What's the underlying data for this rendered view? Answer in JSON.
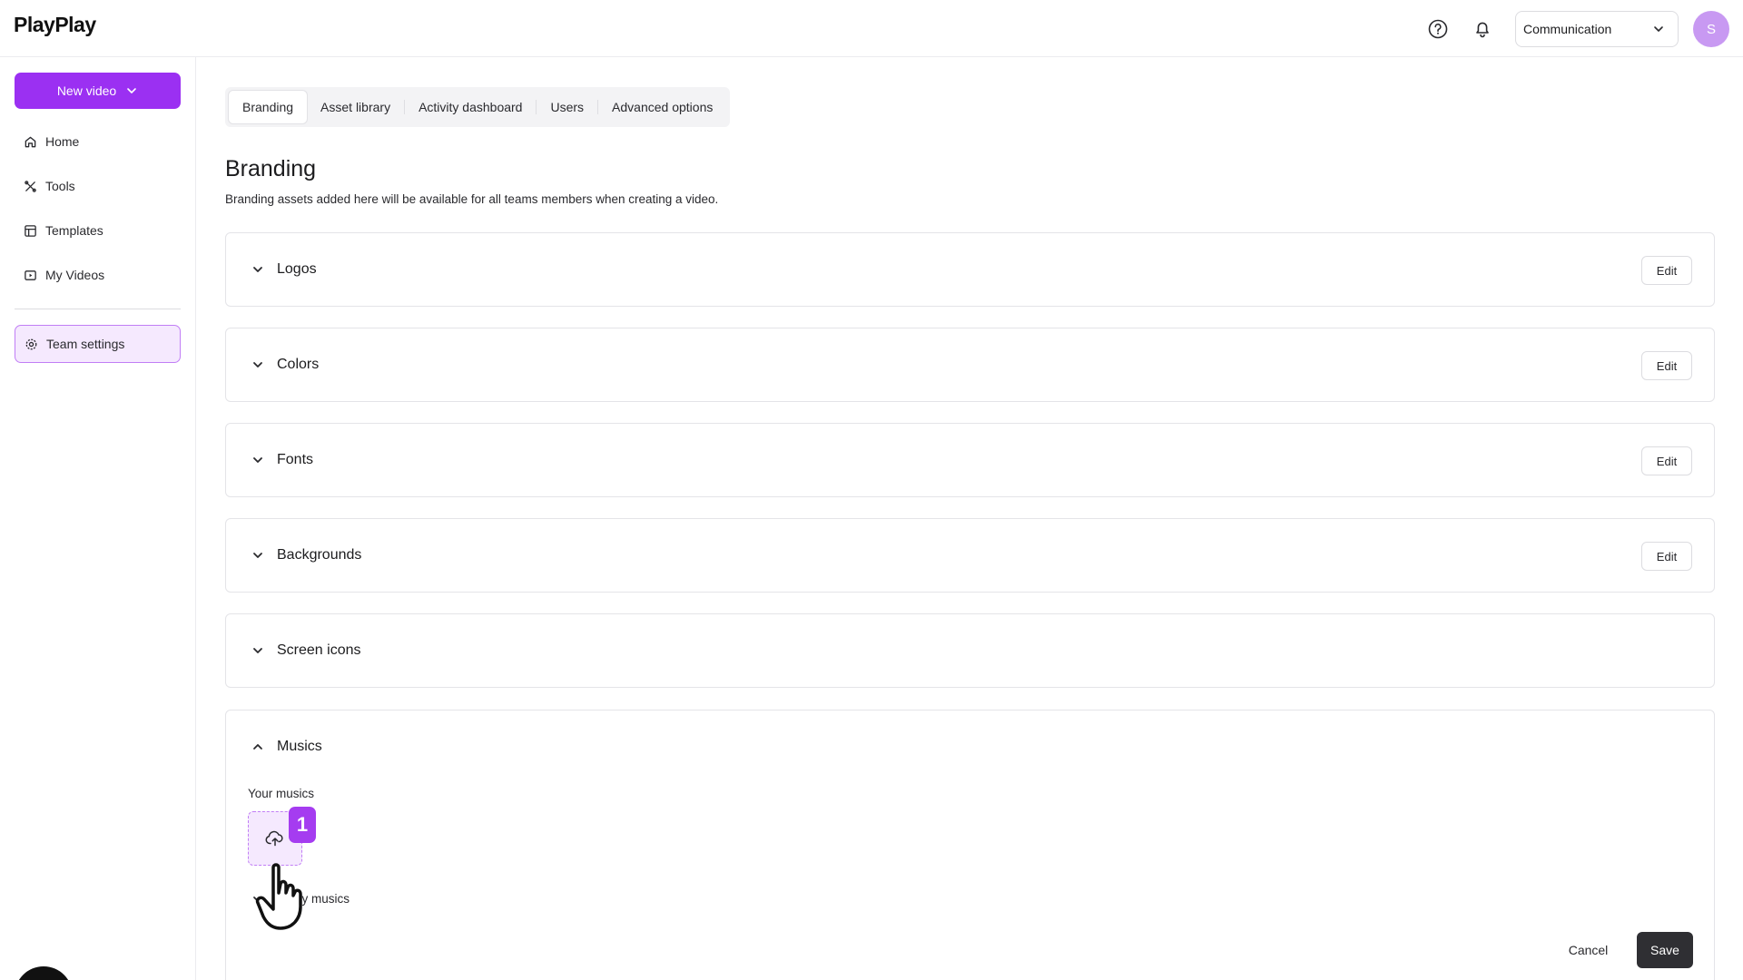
{
  "app": {
    "logo": "PlayPlay"
  },
  "header": {
    "team_select": {
      "value": "Communication"
    },
    "avatar_initial": "S"
  },
  "sidebar": {
    "new_video_label": "New video",
    "items": [
      {
        "label": "Home",
        "icon": "home-icon"
      },
      {
        "label": "Tools",
        "icon": "tools-icon"
      },
      {
        "label": "Templates",
        "icon": "templates-icon"
      },
      {
        "label": "My Videos",
        "icon": "my-videos-icon"
      }
    ],
    "active_item": {
      "label": "Team settings",
      "icon": "gear-icon"
    }
  },
  "tabs": [
    {
      "label": "Branding",
      "active": true
    },
    {
      "label": "Asset library",
      "active": false
    },
    {
      "label": "Activity dashboard",
      "active": false
    },
    {
      "label": "Users",
      "active": false
    },
    {
      "label": "Advanced options",
      "active": false
    }
  ],
  "page": {
    "title": "Branding",
    "subtitle": "Branding assets added here will be available for all teams members when creating a video."
  },
  "sections": [
    {
      "title": "Logos",
      "edit_label": "Edit"
    },
    {
      "title": "Colors",
      "edit_label": "Edit"
    },
    {
      "title": "Fonts",
      "edit_label": "Edit"
    },
    {
      "title": "Backgrounds",
      "edit_label": "Edit"
    },
    {
      "title": "Screen icons"
    }
  ],
  "musics": {
    "title": "Musics",
    "your_musics_label": "Your musics",
    "step_badge": "1",
    "playplay_musics_label": "ay musics",
    "cancel_label": "Cancel",
    "save_label": "Save"
  },
  "colors": {
    "accent": "#9b30f2",
    "accent_light": "#f5e9fe",
    "save_button": "#2f2f33"
  }
}
